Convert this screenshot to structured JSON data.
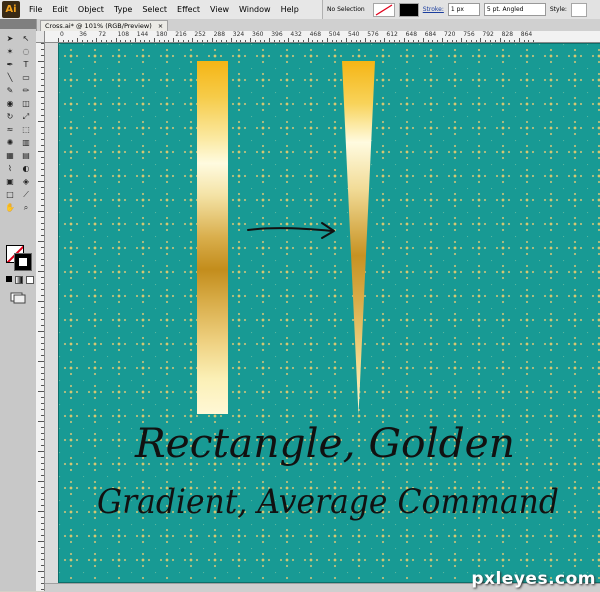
{
  "app": {
    "logo_text": "Ai"
  },
  "menu": [
    {
      "name": "menu-file",
      "label": "File"
    },
    {
      "name": "menu-edit",
      "label": "Edit"
    },
    {
      "name": "menu-object",
      "label": "Object"
    },
    {
      "name": "menu-type",
      "label": "Type"
    },
    {
      "name": "menu-select",
      "label": "Select"
    },
    {
      "name": "menu-effect",
      "label": "Effect"
    },
    {
      "name": "menu-view",
      "label": "View"
    },
    {
      "name": "menu-window",
      "label": "Window"
    },
    {
      "name": "menu-help",
      "label": "Help"
    }
  ],
  "control_bar": {
    "selection_label": "No Selection",
    "stroke_label": "Stroke:",
    "stroke_value": "1 px",
    "brush_value": "5 pt. Angled",
    "style_label": "Style:"
  },
  "document_tab": {
    "title": "Cross.ai* @ 101% (RGB/Preview)",
    "close": "×"
  },
  "ruler_marks": [
    "0",
    "36",
    "72",
    "108",
    "144",
    "180",
    "216",
    "252",
    "288",
    "324",
    "360",
    "396",
    "432",
    "468",
    "504",
    "540",
    "576",
    "612",
    "648",
    "684",
    "720",
    "756",
    "792",
    "828",
    "864"
  ],
  "artwork": {
    "caption_line1": "Rectangle, Golden",
    "caption_line2": "Gradient, Average Command",
    "colors": {
      "pattern_background": "#189a94",
      "gold_dark": "#c38d1c",
      "gold_light": "#fff8d6"
    }
  },
  "watermark": "pxleyes.com"
}
